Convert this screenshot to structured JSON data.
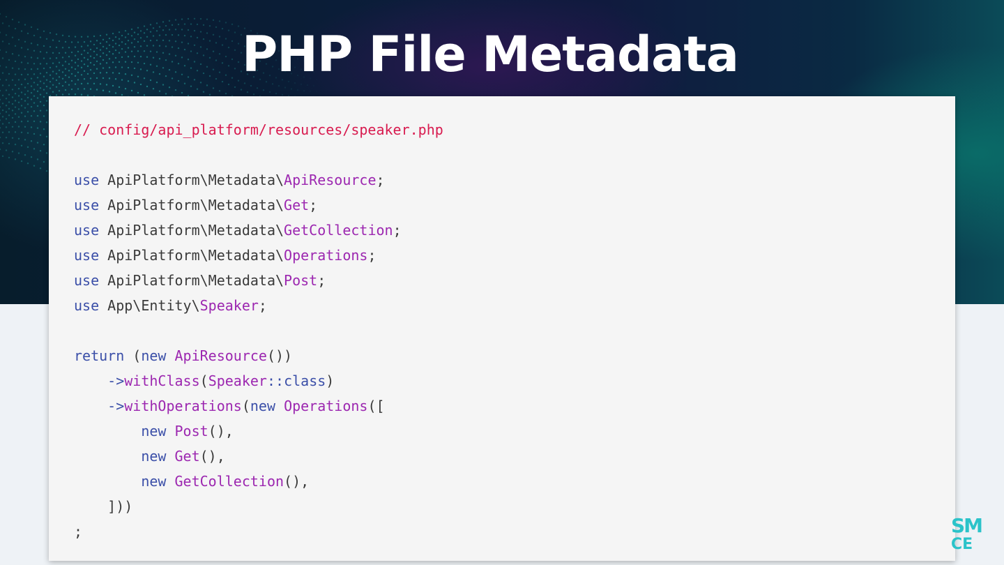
{
  "slide": {
    "title": "PHP File Metadata"
  },
  "colors": {
    "comment": "#d81b4f",
    "keyword": "#3b4fa8",
    "class": "#9c27b0",
    "text": "#3a3a3a",
    "card_background": "#f5f5f5",
    "accent": "#2bc3c9"
  },
  "code": {
    "language": "php",
    "lines": [
      [
        {
          "t": "cmt",
          "v": "// config/api_platform/resources/speaker.php"
        }
      ],
      [],
      [
        {
          "t": "kw",
          "v": "use"
        },
        {
          "t": "plain",
          "v": " ApiPlatform\\Metadata\\"
        },
        {
          "t": "cls",
          "v": "ApiResource"
        },
        {
          "t": "plain",
          "v": ";"
        }
      ],
      [
        {
          "t": "kw",
          "v": "use"
        },
        {
          "t": "plain",
          "v": " ApiPlatform\\Metadata\\"
        },
        {
          "t": "cls",
          "v": "Get"
        },
        {
          "t": "plain",
          "v": ";"
        }
      ],
      [
        {
          "t": "kw",
          "v": "use"
        },
        {
          "t": "plain",
          "v": " ApiPlatform\\Metadata\\"
        },
        {
          "t": "cls",
          "v": "GetCollection"
        },
        {
          "t": "plain",
          "v": ";"
        }
      ],
      [
        {
          "t": "kw",
          "v": "use"
        },
        {
          "t": "plain",
          "v": " ApiPlatform\\Metadata\\"
        },
        {
          "t": "cls",
          "v": "Operations"
        },
        {
          "t": "plain",
          "v": ";"
        }
      ],
      [
        {
          "t": "kw",
          "v": "use"
        },
        {
          "t": "plain",
          "v": " ApiPlatform\\Metadata\\"
        },
        {
          "t": "cls",
          "v": "Post"
        },
        {
          "t": "plain",
          "v": ";"
        }
      ],
      [
        {
          "t": "kw",
          "v": "use"
        },
        {
          "t": "plain",
          "v": " App\\Entity\\"
        },
        {
          "t": "cls",
          "v": "Speaker"
        },
        {
          "t": "plain",
          "v": ";"
        }
      ],
      [],
      [
        {
          "t": "kw",
          "v": "return"
        },
        {
          "t": "plain",
          "v": " ("
        },
        {
          "t": "kw",
          "v": "new"
        },
        {
          "t": "plain",
          "v": " "
        },
        {
          "t": "cls",
          "v": "ApiResource"
        },
        {
          "t": "plain",
          "v": "())"
        }
      ],
      [
        {
          "t": "plain",
          "v": "    "
        },
        {
          "t": "kw",
          "v": "->"
        },
        {
          "t": "cls",
          "v": "withClass"
        },
        {
          "t": "plain",
          "v": "("
        },
        {
          "t": "cls",
          "v": "Speaker"
        },
        {
          "t": "kw",
          "v": "::class"
        },
        {
          "t": "plain",
          "v": ")"
        }
      ],
      [
        {
          "t": "plain",
          "v": "    "
        },
        {
          "t": "kw",
          "v": "->"
        },
        {
          "t": "cls",
          "v": "withOperations"
        },
        {
          "t": "plain",
          "v": "("
        },
        {
          "t": "kw",
          "v": "new"
        },
        {
          "t": "plain",
          "v": " "
        },
        {
          "t": "cls",
          "v": "Operations"
        },
        {
          "t": "plain",
          "v": "(["
        }
      ],
      [
        {
          "t": "plain",
          "v": "        "
        },
        {
          "t": "kw",
          "v": "new"
        },
        {
          "t": "plain",
          "v": " "
        },
        {
          "t": "cls",
          "v": "Post"
        },
        {
          "t": "plain",
          "v": "(),"
        }
      ],
      [
        {
          "t": "plain",
          "v": "        "
        },
        {
          "t": "kw",
          "v": "new"
        },
        {
          "t": "plain",
          "v": " "
        },
        {
          "t": "cls",
          "v": "Get"
        },
        {
          "t": "plain",
          "v": "(),"
        }
      ],
      [
        {
          "t": "plain",
          "v": "        "
        },
        {
          "t": "kw",
          "v": "new"
        },
        {
          "t": "plain",
          "v": " "
        },
        {
          "t": "cls",
          "v": "GetCollection"
        },
        {
          "t": "plain",
          "v": "(),"
        }
      ],
      [
        {
          "t": "plain",
          "v": "    ]))"
        }
      ],
      [
        {
          "t": "plain",
          "v": ";"
        }
      ]
    ]
  },
  "logo": {
    "top_text": "SM",
    "bottom_text": "CE"
  }
}
